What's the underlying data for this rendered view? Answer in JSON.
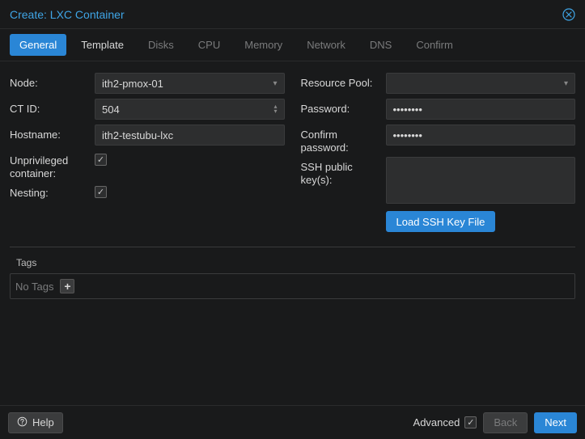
{
  "title": "Create: LXC Container",
  "tabs": [
    "General",
    "Template",
    "Disks",
    "CPU",
    "Memory",
    "Network",
    "DNS",
    "Confirm"
  ],
  "active_tab": 0,
  "left": {
    "node_label": "Node:",
    "node_value": "ith2-pmox-01",
    "ctid_label": "CT ID:",
    "ctid_value": "504",
    "hostname_label": "Hostname:",
    "hostname_value": "ith2-testubu-lxc",
    "unpriv_label": "Unprivileged container:",
    "nesting_label": "Nesting:"
  },
  "right": {
    "pool_label": "Resource Pool:",
    "password_label": "Password:",
    "password_value": "••••••••",
    "confirm_label": "Confirm password:",
    "confirm_value": "••••••••",
    "ssh_label": "SSH public key(s):",
    "ssh_btn": "Load SSH Key File"
  },
  "tags": {
    "label": "Tags",
    "empty": "No Tags"
  },
  "footer": {
    "help": "Help",
    "advanced": "Advanced",
    "back": "Back",
    "next": "Next"
  }
}
